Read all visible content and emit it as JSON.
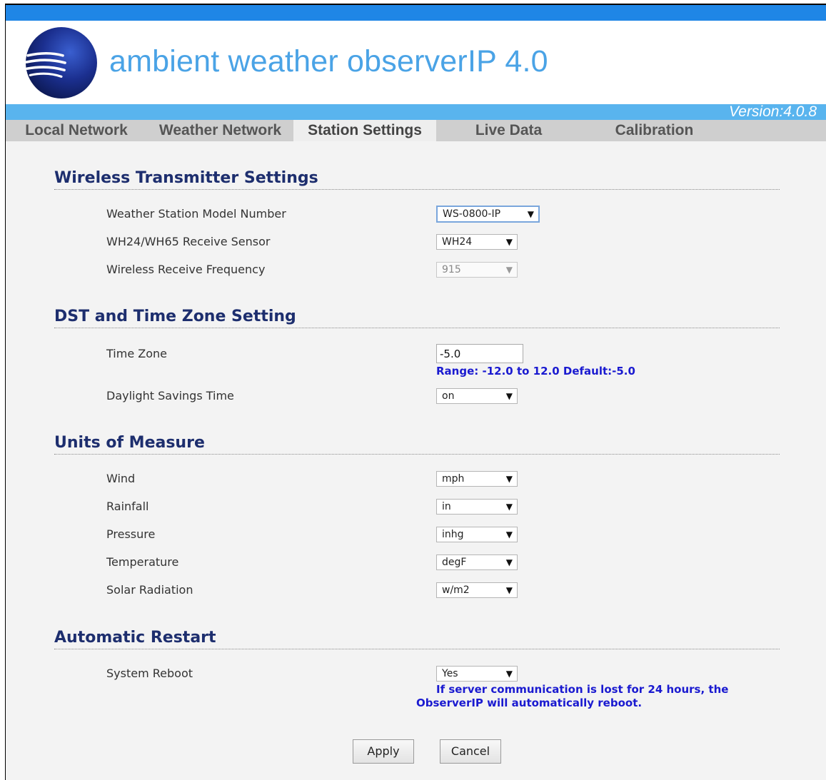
{
  "header": {
    "title": "ambient weather observerIP 4.0",
    "version": "Version:4.0.8"
  },
  "tabs": [
    {
      "label": "Local Network"
    },
    {
      "label": "Weather Network"
    },
    {
      "label": "Station Settings",
      "active": true
    },
    {
      "label": "Live Data"
    },
    {
      "label": "Calibration"
    }
  ],
  "sections": {
    "wireless": {
      "title": "Wireless Transmitter Settings",
      "model_label": "Weather Station Model Number",
      "model_value": "WS-0800-IP",
      "sensor_label": "WH24/WH65 Receive Sensor",
      "sensor_value": "WH24",
      "frequency_label": "Wireless Receive Frequency",
      "frequency_value": "915"
    },
    "dst": {
      "title": "DST and Time Zone Setting",
      "timezone_label": "Time Zone",
      "timezone_value": "-5.0",
      "timezone_hint": "Range: -12.0 to 12.0 Default:-5.0",
      "dst_label": "Daylight Savings Time",
      "dst_value": "on"
    },
    "units": {
      "title": "Units of Measure",
      "wind_label": "Wind",
      "wind_value": "mph",
      "rainfall_label": "Rainfall",
      "rainfall_value": "in",
      "pressure_label": "Pressure",
      "pressure_value": "inhg",
      "temperature_label": "Temperature",
      "temperature_value": "degF",
      "solar_label": "Solar Radiation",
      "solar_value": "w/m2"
    },
    "restart": {
      "title": "Automatic Restart",
      "reboot_label": "System Reboot",
      "reboot_value": "Yes",
      "reboot_hint_line1": "If server communication is lost for 24 hours, the",
      "reboot_hint_line2": "ObserverIP will automatically reboot."
    }
  },
  "buttons": {
    "apply": "Apply",
    "cancel": "Cancel"
  },
  "icons": {
    "dropdown_arrow": "▼",
    "logo": "globe-logo-icon"
  },
  "colors": {
    "top_bar": "#1f86e6",
    "version_bar": "#59b4ee",
    "title_text": "#4aa3e6",
    "section_title": "#1d2e6e",
    "hint_text": "#1a1ad0"
  }
}
